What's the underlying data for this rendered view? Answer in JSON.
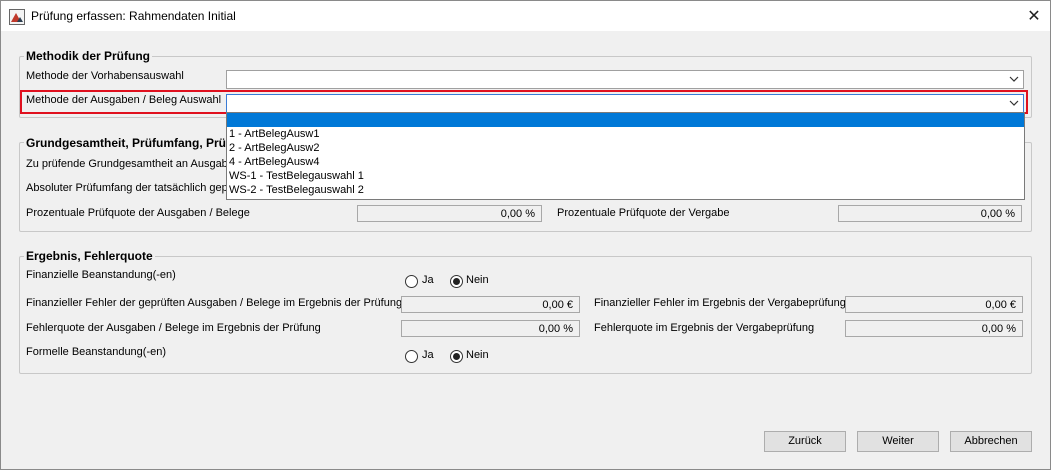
{
  "window": {
    "title": "Prüfung erfassen: Rahmendaten Initial",
    "close_glyph": "✕"
  },
  "methodik": {
    "legend": "Methodik der Prüfung",
    "vorhabensauswahl_label": "Methode der Vorhabensauswahl",
    "vorhabensauswahl_value": "",
    "ausgaben_label": "Methode der Ausgaben / Beleg Auswahl",
    "ausgaben_value": "",
    "dropdown_options": [
      "",
      "1 - ArtBelegAusw1",
      "2 - ArtBelegAusw2",
      "4 - ArtBelegAusw4",
      "WS-1 - TestBelegauswahl 1",
      "WS-2 - TestBelegauswahl 2"
    ]
  },
  "grund": {
    "legend": "Grundgesamtheit, Prüfumfang, Prüf",
    "row1_label": "Zu prüfende Grundgesamtheit an Ausgabe",
    "row2_label": "Absoluter Prüfumfang der tatsächlich gep",
    "quote_ausgaben_label": "Prozentuale Prüfquote der Ausgaben / Belege",
    "quote_ausgaben_value": "0,00 %",
    "quote_vergabe_label": "Prozentuale Prüfquote der Vergabe",
    "quote_vergabe_value": "0,00 %"
  },
  "ergebnis": {
    "legend": "Ergebnis, Fehlerquote",
    "fin_beanstandung_label": "Finanzielle Beanstandung(-en)",
    "ja": "Ja",
    "nein": "Nein",
    "fin_fehler_ausgaben_label": "Finanzieller Fehler der geprüften Ausgaben / Belege im Ergebnis der Prüfung",
    "fin_fehler_ausgaben_value": "0,00 €",
    "fin_fehler_vergabe_label": "Finanzieller Fehler im Ergebnis der Vergabeprüfung",
    "fin_fehler_vergabe_value": "0,00 €",
    "fehlerquote_ausgaben_label": "Fehlerquote der Ausgaben / Belege im Ergebnis der Prüfung",
    "fehlerquote_ausgaben_value": "0,00 %",
    "fehlerquote_vergabe_label": "Fehlerquote im Ergebnis der Vergabeprüfung",
    "fehlerquote_vergabe_value": "0,00 %",
    "formelle_label": "Formelle Beanstandung(-en)",
    "fin_selected": "Nein",
    "formelle_selected": "Nein"
  },
  "buttons": {
    "back": "Zurück",
    "next": "Weiter",
    "cancel": "Abbrechen"
  }
}
